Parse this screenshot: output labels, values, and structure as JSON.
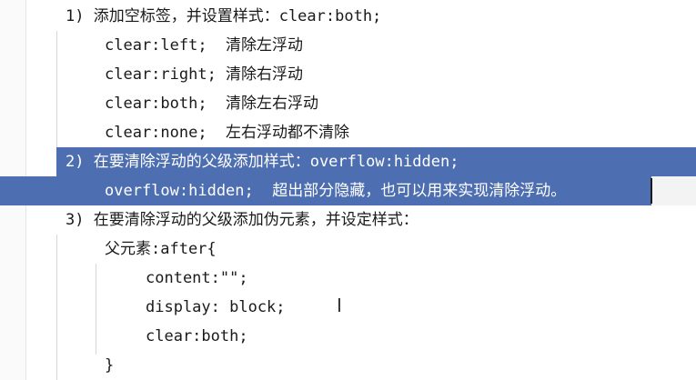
{
  "editor": {
    "lines": [
      {
        "text": "1) 添加空标签，并设置样式：clear:both;"
      },
      {
        "text": "clear:left;  清除左浮动"
      },
      {
        "text": "clear:right; 清除右浮动"
      },
      {
        "text": "clear:both;  清除左右浮动"
      },
      {
        "text": "clear:none;  左右浮动都不清除"
      },
      {
        "text": "2) 在要清除浮动的父级添加样式：overflow:hidden;"
      },
      {
        "text": "overflow:hidden;  超出部分隐藏，也可以用来实现清除浮动。"
      },
      {
        "text": "3) 在要清除浮动的父级添加伪元素，并设定样式："
      },
      {
        "text": "父元素:after{"
      },
      {
        "text": "content:\"\";"
      },
      {
        "text": "display: block;"
      },
      {
        "text": "clear:both;"
      },
      {
        "text": "}"
      }
    ],
    "selection_color": "#4d6fb1",
    "cursor_icon": "text-ibeam-cursor",
    "ibeam_glyph": "I"
  }
}
